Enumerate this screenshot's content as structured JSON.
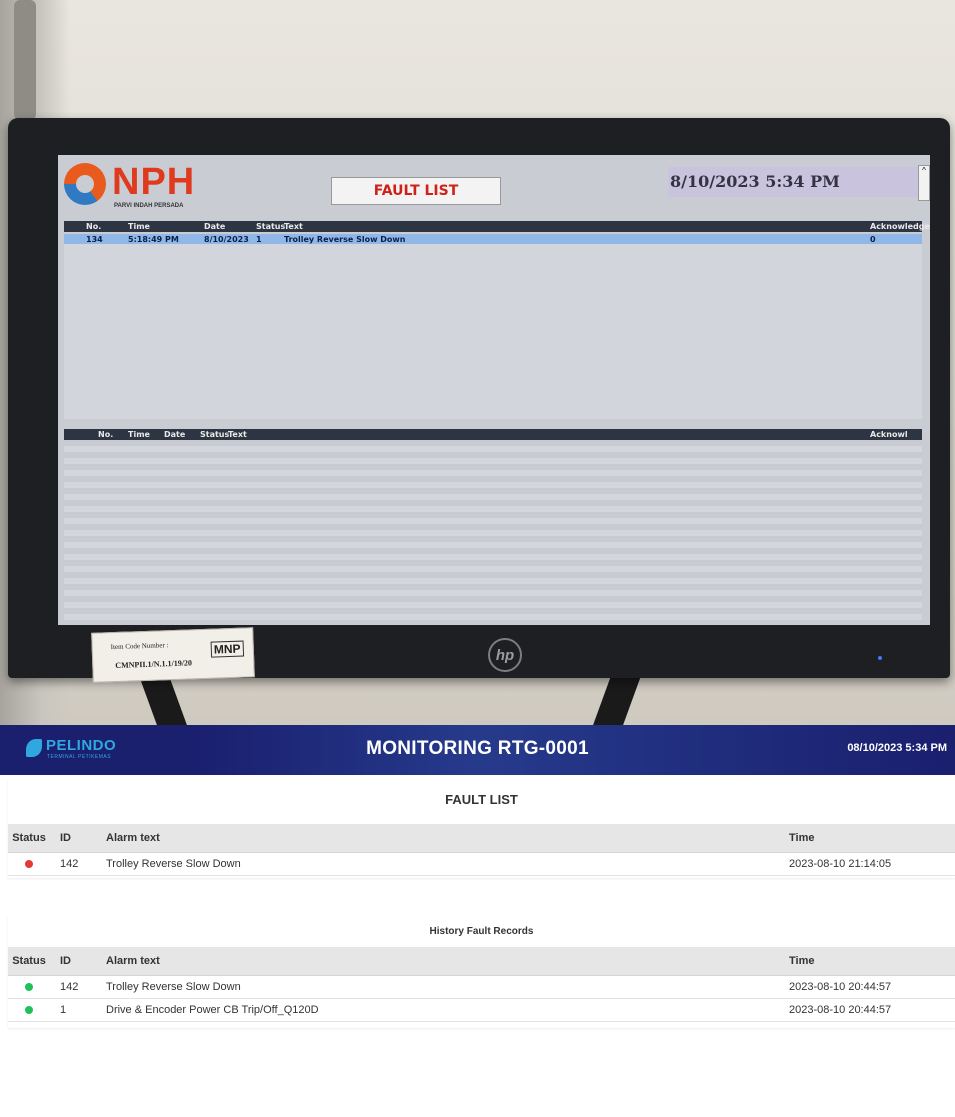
{
  "photo": {
    "screen": {
      "logo_text": "NPH",
      "logo_subtitle": "PARVI INDAH PERSADA",
      "title": "FAULT LIST",
      "datetime": "8/10/2023 5:34 PM",
      "table_headers": [
        "No.",
        "Time",
        "Date",
        "Status",
        "Text",
        "Acknowledge"
      ],
      "selected_row": {
        "no": "134",
        "time": "5:18:49 PM",
        "date": "8/10/2023",
        "status": "1",
        "text": "Trolley Reverse Slow Down",
        "ack": "0"
      },
      "history_headers": [
        "No.",
        "Time",
        "Date",
        "Status",
        "Text",
        "Acknowl"
      ]
    },
    "sticker": {
      "line1": "Item Code Number :",
      "line2": "CMNPII.1/N.1.1/19/20",
      "brand": "MNP"
    },
    "bezel_logo": "hp"
  },
  "header": {
    "brand": "PELINDO",
    "brand_tagline": "TERMINAL PETIKEMAS",
    "title": "MONITORING RTG-0001",
    "datetime": "08/10/2023 5:34 PM"
  },
  "fault_list": {
    "title": "FAULT LIST",
    "columns": {
      "status": "Status",
      "id": "ID",
      "text": "Alarm text",
      "time": "Time"
    },
    "rows": [
      {
        "status": "red",
        "id": "142",
        "text": "Trolley Reverse Slow Down",
        "time": "2023-08-10 21:14:05"
      }
    ]
  },
  "history": {
    "title": "History Fault Records",
    "columns": {
      "status": "Status",
      "id": "ID",
      "text": "Alarm text",
      "time": "Time"
    },
    "rows": [
      {
        "status": "green",
        "id": "142",
        "text": "Trolley Reverse Slow Down",
        "time": "2023-08-10 20:44:57"
      },
      {
        "status": "green",
        "id": "1",
        "text": "Drive & Encoder Power CB Trip/Off_Q120D",
        "time": "2023-08-10 20:44:57"
      }
    ]
  },
  "colors": {
    "topbar": "#1a1f6e",
    "brand": "#2fa8e0",
    "alarm_active": "#e53935",
    "alarm_cleared": "#22c05a",
    "screen_title": "#d0201a"
  }
}
